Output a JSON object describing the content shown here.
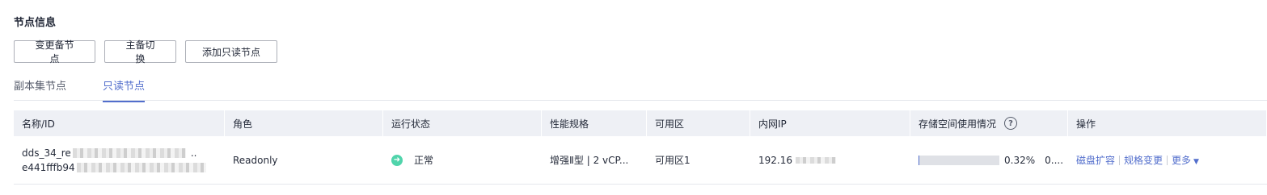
{
  "section": {
    "title": "节点信息"
  },
  "toolbar": {
    "change_standby": "变更备节点",
    "switchover": "主备切换",
    "add_readonly": "添加只读节点"
  },
  "tabs": [
    {
      "label": "副本集节点",
      "active": false
    },
    {
      "label": "只读节点",
      "active": true
    }
  ],
  "table": {
    "columns": [
      "名称/ID",
      "角色",
      "运行状态",
      "性能规格",
      "可用区",
      "内网IP",
      "存储空间使用情况",
      "操作"
    ],
    "rows": [
      {
        "name": "dds_34_re",
        "id": "e441fffb94",
        "role": "Readonly",
        "status": "正常",
        "spec": "增强Ⅱ型 | 2 vCP...",
        "az": "可用区1",
        "ip": "192.16",
        "storage_percent": 0.32,
        "storage_percent_label": "0.32%",
        "storage_extra": "0....",
        "actions": {
          "expand": "磁盘扩容",
          "resize": "规格变更",
          "more": "更多"
        }
      }
    ]
  },
  "colors": {
    "accent": "#526ecc",
    "status_ok": "#50d4ab",
    "header_bg": "#eef0f5"
  }
}
